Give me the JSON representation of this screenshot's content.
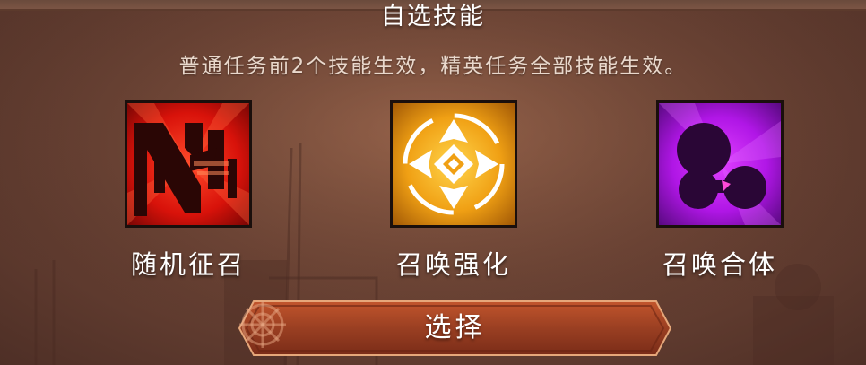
{
  "dialog": {
    "title": "自选技能",
    "subtitle": "普通任务前2个技能生效，精英任务全部技能生效。"
  },
  "skills": [
    {
      "name": "随机征召",
      "icon": "random-summon-icon",
      "color": "#e11d0c"
    },
    {
      "name": "召唤强化",
      "icon": "summon-enhance-icon",
      "color": "#f3a01a"
    },
    {
      "name": "召唤合体",
      "icon": "summon-merge-icon",
      "color": "#b016e6"
    }
  ],
  "actions": {
    "select_label": "选择"
  },
  "colors": {
    "background": "#6e4536",
    "button": "#9a3f22",
    "text": "#ffffff"
  }
}
